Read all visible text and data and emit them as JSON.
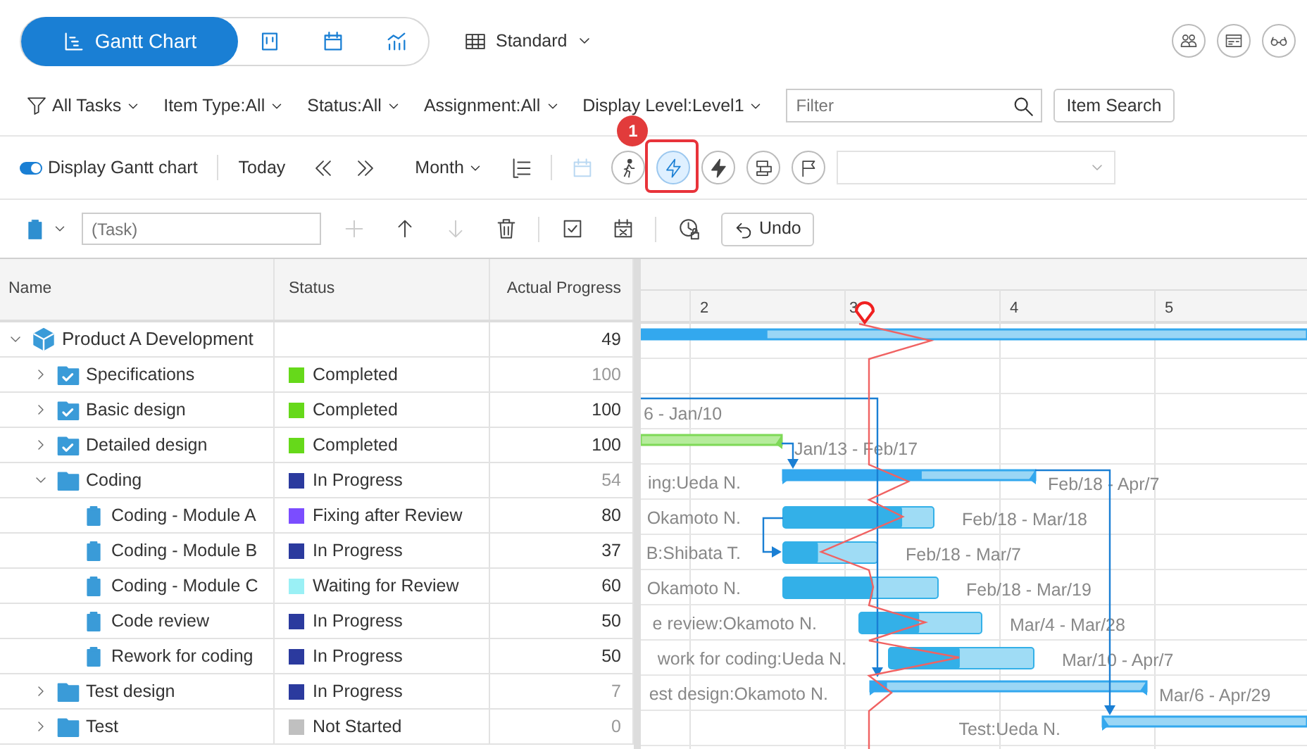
{
  "views": [
    {
      "label": "Gantt Chart",
      "selected": true
    },
    {
      "selected": false
    },
    {
      "selected": false
    },
    {
      "selected": false
    }
  ],
  "layout_menu": {
    "label": "Standard"
  },
  "filters": [
    {
      "label": "All Tasks"
    },
    {
      "label": "Item Type:All"
    },
    {
      "label": "Status:All"
    },
    {
      "label": "Assignment:All"
    },
    {
      "label": "Display Level:Level1"
    }
  ],
  "filter_field": {
    "placeholder": "Filter"
  },
  "item_search": "Item Search",
  "gantt_toolbar": {
    "toggle": {
      "label": "Display Gantt chart",
      "on": true
    },
    "today": "Today",
    "scale": "Month",
    "tools": [
      {
        "disabled": false,
        "selected": false
      },
      {
        "disabled": true,
        "selected": false
      },
      {
        "disabled": false,
        "selected": false
      },
      {
        "disabled": false,
        "selected": true,
        "callout": "1"
      },
      {
        "disabled": false,
        "selected": false
      },
      {
        "disabled": false,
        "selected": false
      },
      {
        "disabled": false,
        "selected": false
      }
    ]
  },
  "task_toolbar": {
    "placeholder": "(Task)",
    "tools": [
      {
        "disabled": true
      },
      {
        "disabled": false
      },
      {
        "disabled": true
      },
      {
        "disabled": false
      },
      {
        "disabled": false
      },
      {
        "disabled": false
      },
      {
        "disabled": false
      }
    ],
    "undo": "Undo"
  },
  "columns": [
    "Name",
    "Status",
    "Actual Progress"
  ],
  "months": [
    "2",
    "3",
    "4",
    "5"
  ],
  "rows": [
    {
      "name": "Product A Development",
      "kind": "package",
      "expanded": true,
      "progress": "49",
      "progress_muted": false,
      "gantt": {
        "kind": "summary",
        "level": 0.19
      },
      "children": [
        {
          "name": "Specifications",
          "kind": "task-group",
          "expanded": false,
          "status": "Completed",
          "color": "#66d91a",
          "progress": "100",
          "progress_muted": true,
          "gantt": {
            "kind": "none"
          }
        },
        {
          "name": "Basic design",
          "kind": "task-group",
          "expanded": false,
          "status": "Completed",
          "color": "#66d91a",
          "progress": "100",
          "progress_muted": false,
          "gantt": {
            "kind": "none",
            "dates": "6 - Jan/10"
          }
        },
        {
          "name": "Detailed design",
          "kind": "task-group",
          "expanded": false,
          "status": "Completed",
          "color": "#66d91a",
          "progress": "100",
          "progress_muted": false,
          "gantt": {
            "kind": "done",
            "dates": "Jan/13 - Feb/17"
          }
        },
        {
          "name": "Coding",
          "kind": "folder",
          "expanded": true,
          "status": "In Progress",
          "color": "#2b3a9e",
          "progress": "54",
          "progress_muted": true,
          "gantt": {
            "kind": "summary",
            "label": "ing:Ueda N.",
            "dates": "Feb/18 - Apr/7",
            "level": 0.55
          },
          "children": [
            {
              "name": "Coding - Module A",
              "kind": "task",
              "status": "Fixing after Review",
              "color": "#7b4dff",
              "progress": "80",
              "progress_muted": false,
              "gantt": {
                "kind": "task",
                "label": "Okamoto N.",
                "dates": "Feb/18 - Mar/18",
                "level": 0.79
              }
            },
            {
              "name": "Coding - Module B",
              "kind": "task",
              "status": "In Progress",
              "color": "#2b3a9e",
              "progress": "37",
              "progress_muted": false,
              "gantt": {
                "kind": "task",
                "label": "B:Shibata T.",
                "dates": "Feb/18 - Mar/7",
                "level": 0.37
              }
            },
            {
              "name": "Coding - Module C",
              "kind": "task",
              "status": "Waiting for Review",
              "color": "#9af0f5",
              "progress": "60",
              "progress_muted": false,
              "gantt": {
                "kind": "task",
                "label": "Okamoto N.",
                "dates": "Feb/18 - Mar/19",
                "level": 0.58
              }
            },
            {
              "name": "Code review",
              "kind": "task",
              "status": "In Progress",
              "color": "#2b3a9e",
              "progress": "50",
              "progress_muted": false,
              "gantt": {
                "kind": "task",
                "label": "e review:Okamoto N.",
                "dates": "Mar/4 - Mar/28",
                "level": 0.49
              }
            },
            {
              "name": "Rework for coding",
              "kind": "task",
              "status": "In Progress",
              "color": "#2b3a9e",
              "progress": "50",
              "progress_muted": false,
              "gantt": {
                "kind": "task",
                "label": "work for coding:Ueda N.",
                "dates": "Mar/10 - Apr/7",
                "level": 0.49
              }
            }
          ]
        },
        {
          "name": "Test design",
          "kind": "folder",
          "expanded": false,
          "status": "In Progress",
          "color": "#2b3a9e",
          "progress": "7",
          "progress_muted": true,
          "gantt": {
            "kind": "summary",
            "label": "est design:Okamoto N.",
            "dates": "Mar/6 - Apr/29",
            "level": 0.06
          }
        },
        {
          "name": "Test",
          "kind": "folder",
          "expanded": false,
          "status": "Not Started",
          "color": "#c0c0c0",
          "progress": "0",
          "progress_muted": true,
          "gantt": {
            "kind": "summary",
            "label": "Test:Ueda N."
          }
        }
      ]
    }
  ]
}
